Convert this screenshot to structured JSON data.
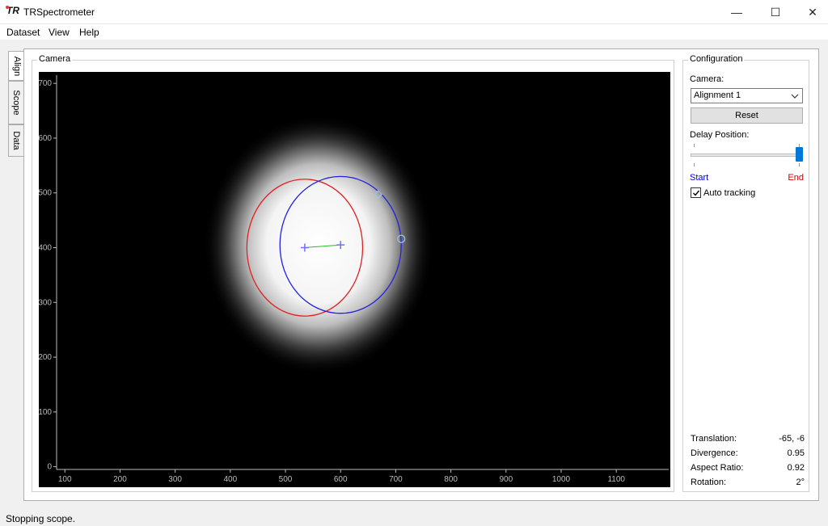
{
  "window": {
    "title": "TRSpectrometer",
    "logo_text": "TR",
    "min_glyph": "—",
    "max_glyph": "☐",
    "close_glyph": "✕"
  },
  "menu": {
    "items": [
      "Dataset",
      "View",
      "Help"
    ]
  },
  "tabs": [
    {
      "label": "Align",
      "active": true
    },
    {
      "label": "Scope",
      "active": false
    },
    {
      "label": "Data",
      "active": false
    }
  ],
  "camera": {
    "title": "Camera",
    "plot": {
      "x_ticks": [
        100,
        200,
        300,
        400,
        500,
        600,
        700,
        800,
        900,
        1000,
        1100
      ],
      "y_ticks": [
        0,
        100,
        200,
        300,
        400,
        500,
        600,
        700
      ],
      "xlim": [
        85,
        1195
      ],
      "ylim": [
        -5,
        715
      ],
      "beam": {
        "cx": 560,
        "cy": 405,
        "rx": 110,
        "ry": 125
      },
      "red_ellipse": {
        "cx": 535,
        "cy": 400,
        "rx": 105,
        "ry": 125
      },
      "blue_ellipse": {
        "cx": 600,
        "cy": 405,
        "rx": 110,
        "ry": 125
      },
      "red_center": {
        "x": 535,
        "y": 400
      },
      "blue_center": {
        "x": 600,
        "y": 405
      },
      "diamond_handle": {
        "x": 668,
        "y": 497
      },
      "circle_handle": {
        "x": 710,
        "y": 416
      },
      "colors": {
        "red": "#e02020",
        "blue": "#2020e0",
        "green": "#20c020",
        "cross": "#7070ff"
      }
    }
  },
  "config": {
    "title": "Configuration",
    "camera_label": "Camera:",
    "camera_value": "Alignment 1",
    "reset_label": "Reset",
    "delay_label": "Delay Position:",
    "delay_value": 1.0,
    "start_label": "Start",
    "end_label": "End",
    "start_color": "#0000cc",
    "end_color": "#cc0000",
    "auto_tracking_label": "Auto tracking",
    "auto_tracking_checked": true,
    "stats": [
      {
        "key": "Translation:",
        "value": "-65, -6"
      },
      {
        "key": "Divergence:",
        "value": "0.95"
      },
      {
        "key": "Aspect Ratio:",
        "value": "0.92"
      },
      {
        "key": "Rotation:",
        "value": "2°"
      }
    ]
  },
  "status": {
    "text": "Stopping scope."
  }
}
